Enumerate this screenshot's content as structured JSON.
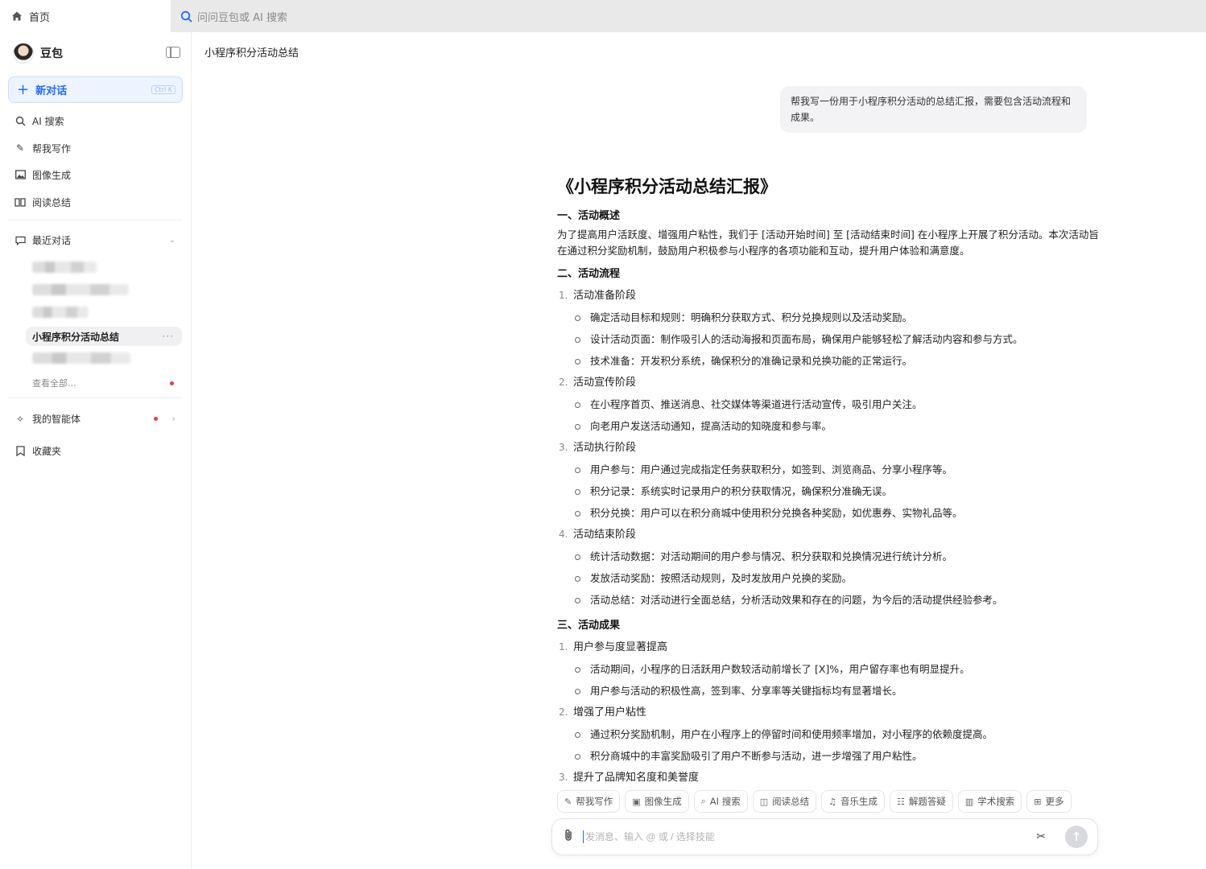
{
  "topbar": {
    "home_label": "首页",
    "search_placeholder": "问问豆包或 AI 搜索"
  },
  "sidebar": {
    "brand_name": "豆包",
    "new_chat_label": "新对话",
    "new_chat_shortcut": "Ctrl K",
    "nav": [
      {
        "label": "AI 搜索",
        "icon": "ai-search-icon"
      },
      {
        "label": "帮我写作",
        "icon": "writing-icon"
      },
      {
        "label": "图像生成",
        "icon": "image-icon"
      },
      {
        "label": "阅读总结",
        "icon": "reading-icon"
      }
    ],
    "recent_label": "最近对话",
    "active_chat": "小程序积分活动总结",
    "view_all": "查看全部...",
    "agents_label": "我的智能体",
    "favorites_label": "收藏夹"
  },
  "main": {
    "page_title": "小程序积分活动总结",
    "user_message": "帮我写一份用于小程序积分活动的总结汇报，需要包含活动流程和成果。",
    "doc": {
      "title": "《小程序积分活动总结汇报》",
      "s1_title": "一、活动概述",
      "s1_para": "为了提高用户活跃度、增强用户粘性，我们于 [活动开始时间] 至 [活动结束时间] 在小程序上开展了积分活动。本次活动旨在通过积分奖励机制，鼓励用户积极参与小程序的各项功能和互动，提升用户体验和满意度。",
      "s2_title": "二、活动流程",
      "s2_items": [
        {
          "num": "1.",
          "label": "活动准备阶段",
          "subs": [
            "确定活动目标和规则：明确积分获取方式、积分兑换规则以及活动奖励。",
            "设计活动页面：制作吸引人的活动海报和页面布局，确保用户能够轻松了解活动内容和参与方式。",
            "技术准备：开发积分系统，确保积分的准确记录和兑换功能的正常运行。"
          ]
        },
        {
          "num": "2.",
          "label": "活动宣传阶段",
          "subs": [
            "在小程序首页、推送消息、社交媒体等渠道进行活动宣传，吸引用户关注。",
            "向老用户发送活动通知，提高活动的知晓度和参与率。"
          ]
        },
        {
          "num": "3.",
          "label": "活动执行阶段",
          "subs": [
            "用户参与：用户通过完成指定任务获取积分，如签到、浏览商品、分享小程序等。",
            "积分记录：系统实时记录用户的积分获取情况，确保积分准确无误。",
            "积分兑换：用户可以在积分商城中使用积分兑换各种奖励，如优惠券、实物礼品等。"
          ]
        },
        {
          "num": "4.",
          "label": "活动结束阶段",
          "subs": [
            "统计活动数据：对活动期间的用户参与情况、积分获取和兑换情况进行统计分析。",
            "发放活动奖励：按照活动规则，及时发放用户兑换的奖励。",
            "活动总结：对活动进行全面总结，分析活动效果和存在的问题，为今后的活动提供经验参考。"
          ]
        }
      ],
      "s3_title": "三、活动成果",
      "s3_items": [
        {
          "num": "1.",
          "label": "用户参与度显著提高",
          "subs": [
            "活动期间，小程序的日活跃用户数较活动前增长了 [X]%，用户留存率也有明显提升。",
            "用户参与活动的积极性高，签到率、分享率等关键指标均有显著增长。"
          ]
        },
        {
          "num": "2.",
          "label": "增强了用户粘性",
          "subs": [
            "通过积分奖励机制，用户在小程序上的停留时间和使用频率增加，对小程序的依赖度提高。",
            "积分商城中的丰富奖励吸引了用户不断参与活动，进一步增强了用户粘性。"
          ]
        },
        {
          "num": "3.",
          "label": "提升了品牌知名度和美誉度",
          "subs": []
        }
      ]
    },
    "skills": [
      {
        "label": "帮我写作",
        "icon": "writing-icon",
        "glyph": "✎"
      },
      {
        "label": "图像生成",
        "icon": "image-icon",
        "glyph": "▣"
      },
      {
        "label": "AI 搜索",
        "icon": "ai-search-icon",
        "glyph": "⌕"
      },
      {
        "label": "阅读总结",
        "icon": "reading-icon",
        "glyph": "◫"
      },
      {
        "label": "音乐生成",
        "icon": "music-icon",
        "glyph": "♫"
      },
      {
        "label": "解题答疑",
        "icon": "qa-icon",
        "glyph": "☷"
      },
      {
        "label": "学术搜索",
        "icon": "academic-icon",
        "glyph": "▥"
      },
      {
        "label": "更多",
        "icon": "more-grid-icon",
        "glyph": "⊞"
      }
    ],
    "composer_placeholder": "发消息、输入 @ 或 / 选择技能"
  },
  "colors": {
    "accent": "#1f6bff",
    "active_bg": "#f0f0f2",
    "notification_dot": "#ee3a3a"
  }
}
